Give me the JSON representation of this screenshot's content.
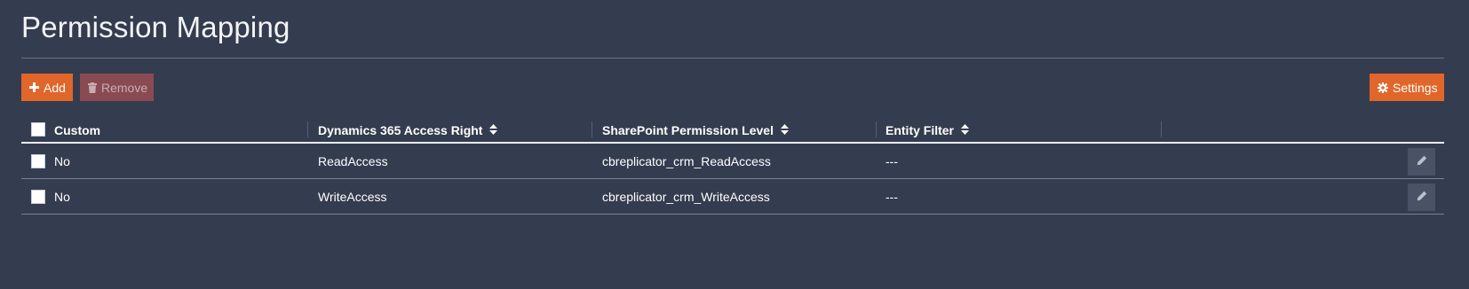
{
  "page": {
    "title": "Permission Mapping"
  },
  "toolbar": {
    "add_label": "Add",
    "remove_label": "Remove",
    "settings_label": "Settings"
  },
  "table": {
    "columns": [
      {
        "label": "Custom",
        "sortable": false
      },
      {
        "label": "Dynamics 365 Access Right",
        "sortable": true
      },
      {
        "label": "SharePoint Permission Level",
        "sortable": true
      },
      {
        "label": "Entity Filter",
        "sortable": true
      }
    ],
    "rows": [
      {
        "custom": "No",
        "access_right": "ReadAccess",
        "permission_level": "cbreplicator_crm_ReadAccess",
        "entity_filter": "---"
      },
      {
        "custom": "No",
        "access_right": "WriteAccess",
        "permission_level": "cbreplicator_crm_WriteAccess",
        "entity_filter": "---"
      }
    ]
  },
  "colors": {
    "background": "#343c4f",
    "accent": "#e0662a",
    "remove_disabled": "#8a4a52",
    "edit_button": "#4a5365"
  },
  "icons": {
    "add": "plus-icon",
    "remove": "trash-icon",
    "settings": "gear-icon",
    "sort": "sort-icon",
    "edit": "pencil-icon"
  }
}
